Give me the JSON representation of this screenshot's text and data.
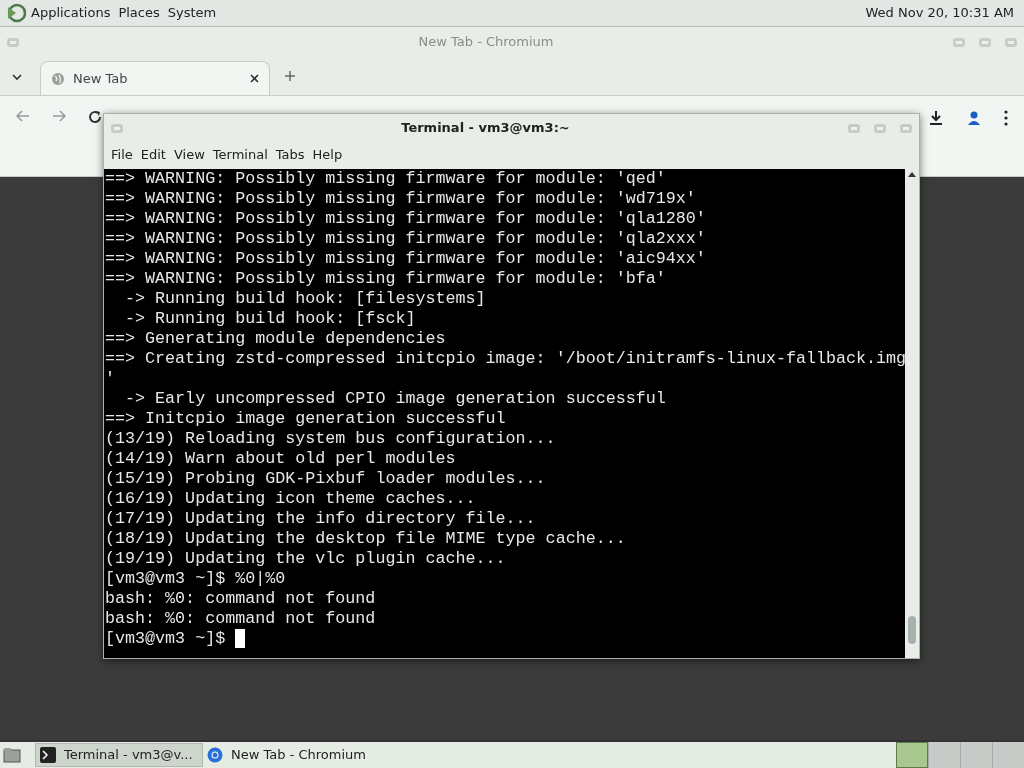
{
  "top_panel": {
    "menus": [
      "Applications",
      "Places",
      "System"
    ],
    "clock": "Wed Nov 20, 10:31 AM"
  },
  "browser": {
    "title": "New Tab - Chromium",
    "tabs": [
      {
        "label": "New Tab",
        "selected": true
      }
    ]
  },
  "terminal": {
    "title": "Terminal - vm3@vm3:~",
    "menus": [
      "File",
      "Edit",
      "View",
      "Terminal",
      "Tabs",
      "Help"
    ],
    "lines": [
      "==> WARNING: Possibly missing firmware for module: 'qed'",
      "==> WARNING: Possibly missing firmware for module: 'wd719x'",
      "==> WARNING: Possibly missing firmware for module: 'qla1280'",
      "==> WARNING: Possibly missing firmware for module: 'qla2xxx'",
      "==> WARNING: Possibly missing firmware for module: 'aic94xx'",
      "==> WARNING: Possibly missing firmware for module: 'bfa'",
      "  -> Running build hook: [filesystems]",
      "  -> Running build hook: [fsck]",
      "==> Generating module dependencies",
      "==> Creating zstd-compressed initcpio image: '/boot/initramfs-linux-fallback.img",
      "'",
      "  -> Early uncompressed CPIO image generation successful",
      "==> Initcpio image generation successful",
      "(13/19) Reloading system bus configuration...",
      "(14/19) Warn about old perl modules",
      "(15/19) Probing GDK-Pixbuf loader modules...",
      "(16/19) Updating icon theme caches...",
      "(17/19) Updating the info directory file...",
      "(18/19) Updating the desktop file MIME type cache...",
      "(19/19) Updating the vlc plugin cache...",
      "[vm3@vm3 ~]$ %0|%0",
      "bash: %0: command not found",
      "bash: %0: command not found"
    ],
    "prompt": "[vm3@vm3 ~]$ "
  },
  "taskbar": {
    "tasks": [
      {
        "label": "Terminal - vm3@v...",
        "kind": "terminal",
        "selected": true
      },
      {
        "label": "New Tab - Chromium",
        "kind": "browser",
        "selected": false
      }
    ]
  }
}
